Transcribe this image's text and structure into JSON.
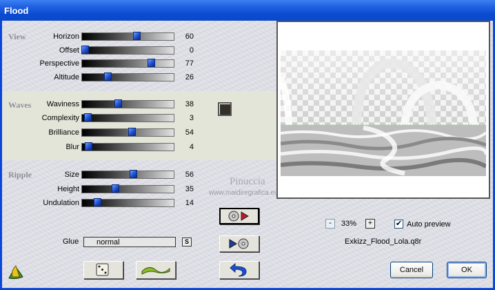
{
  "window": {
    "title": "Flood"
  },
  "groups": {
    "view": {
      "title": "View",
      "params": [
        {
          "label": "Horizon",
          "value": "60",
          "level": 0.6
        },
        {
          "label": "Offset",
          "value": "0",
          "level": 0.0
        },
        {
          "label": "Perspective",
          "value": "77",
          "level": 0.77
        },
        {
          "label": "Altitude",
          "value": "26",
          "level": 0.26
        }
      ]
    },
    "waves": {
      "title": "Waves",
      "params": [
        {
          "label": "Waviness",
          "value": "38",
          "level": 0.38
        },
        {
          "label": "Complexity",
          "value": "3",
          "level": 0.03
        },
        {
          "label": "Brilliance",
          "value": "54",
          "level": 0.54
        },
        {
          "label": "Blur",
          "value": "4",
          "level": 0.04
        }
      ],
      "color": "#33302a"
    },
    "ripple": {
      "title": "Ripple",
      "params": [
        {
          "label": "Size",
          "value": "56",
          "level": 0.56
        },
        {
          "label": "Height",
          "value": "35",
          "level": 0.35
        },
        {
          "label": "Undulation",
          "value": "14",
          "level": 0.14
        }
      ]
    }
  },
  "glue": {
    "label": "Glue",
    "value": "normal",
    "button": "S"
  },
  "watermark": {
    "line1": "Pinuccia",
    "line2": "www.maidiregrafica.eu"
  },
  "zoom": {
    "minus": "-",
    "value": "33%",
    "plus": "+"
  },
  "auto_preview": {
    "label": "Auto preview",
    "checked": true
  },
  "filename": "Exkizz_Flood_Lola.q8r",
  "buttons": {
    "cancel": "Cancel",
    "ok": "OK"
  },
  "icons": {
    "app": "lotus-icon",
    "randomize": "dice-icon",
    "wave": "wave-icon",
    "load_preset": "disc-play-icon",
    "save_preset": "play-disc-icon",
    "reset": "undo-arrow-icon"
  }
}
